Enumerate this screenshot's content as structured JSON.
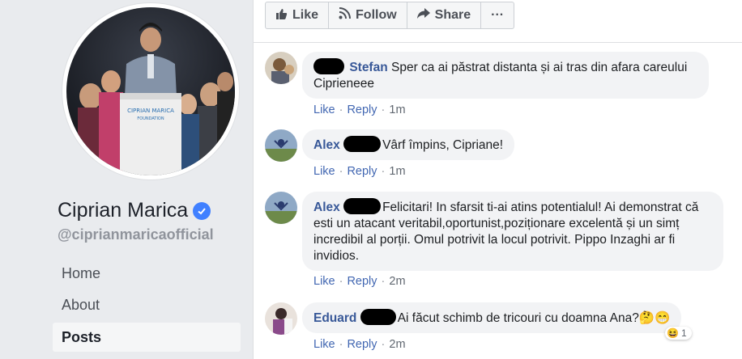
{
  "sidebar": {
    "page_name": "Ciprian Marica",
    "handle": "@ciprianmaricaofficial",
    "podium_logo_line1": "CIPRIAN MARICA",
    "podium_logo_line2": "FOUNDATION",
    "nav": [
      {
        "label": "Home",
        "active": false
      },
      {
        "label": "About",
        "active": false
      },
      {
        "label": "Posts",
        "active": true
      }
    ]
  },
  "action_bar": {
    "like": "Like",
    "follow": "Follow",
    "share": "Share",
    "more": "···"
  },
  "comments": [
    {
      "author": "Stefan",
      "text": "Sper ca ai păstrat distanta și ai tras din afara careului Ciprieneee",
      "like": "Like",
      "reply": "Reply",
      "time": "1m"
    },
    {
      "author": "Alex",
      "text": "Vârf împins, Cipriane!",
      "like": "Like",
      "reply": "Reply",
      "time": "1m"
    },
    {
      "author": "Alex",
      "text": "Felicitari! In sfarsit ti-ai atins potentialul! Ai demonstrat că esti un atacant veritabil,oportunist,poziționare excelentă și un simț incredibil al porții. Omul potrivit la locul potrivit. Pippo Inzaghi ar fi invidios.",
      "like": "Like",
      "reply": "Reply",
      "time": "2m"
    },
    {
      "author": "Eduard",
      "text": "Ai făcut schimb de tricouri cu doamna Ana?🤔😁",
      "like": "Like",
      "reply": "Reply",
      "time": "2m",
      "reaction_emoji": "😆",
      "reaction_count": "1"
    }
  ],
  "colors": {
    "link_blue": "#385898",
    "bubble_bg": "#f2f3f5",
    "page_bg": "#e9ebee",
    "verified_blue": "#4080ff"
  },
  "icons": {
    "like": "thumbs-up-icon",
    "follow": "rss-icon",
    "share": "share-arrow-icon",
    "verified": "verified-check-icon"
  }
}
